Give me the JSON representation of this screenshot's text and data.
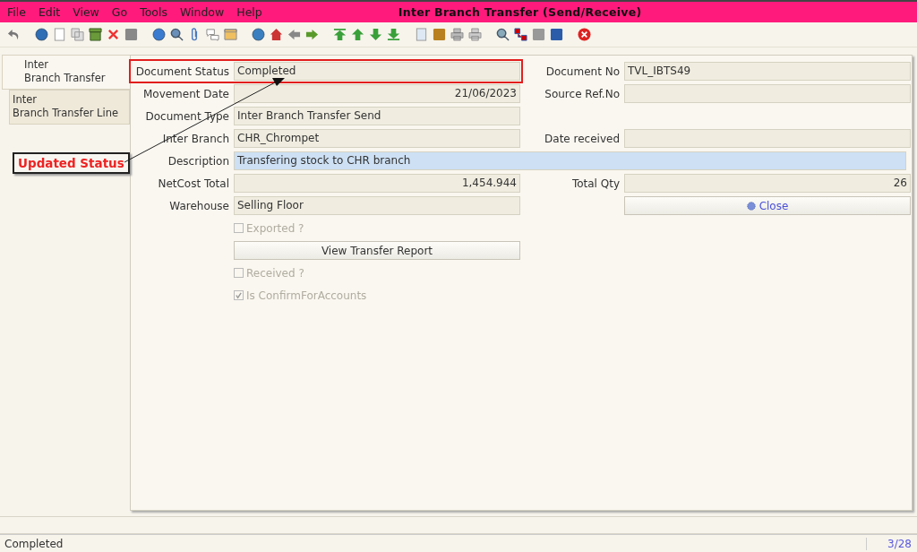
{
  "window": {
    "title": "Inter Branch Transfer (Send/Receive)"
  },
  "menu": [
    "File",
    "Edit",
    "View",
    "Go",
    "Tools",
    "Window",
    "Help"
  ],
  "tabs": [
    {
      "label": "Inter\nBranch Transfer",
      "selected": true
    },
    {
      "label": "Inter\nBranch Transfer Line",
      "selected": false
    }
  ],
  "rows": [
    {
      "highlighted": true,
      "left": {
        "kind": "text",
        "label": "Document Status",
        "value": "Completed",
        "editable": false
      },
      "right": {
        "kind": "text",
        "label": "Document No",
        "value": "TVL_IBTS49",
        "editable": false
      }
    },
    {
      "highlighted": false,
      "left": {
        "kind": "date",
        "label": "Movement Date",
        "value": "21/06/2023",
        "editable": false
      },
      "right": {
        "kind": "text",
        "label": "Source Ref.No",
        "editable": false
      }
    },
    {
      "highlighted": false,
      "left": {
        "kind": "text",
        "label": "Document Type",
        "value": "Inter Branch Transfer Send",
        "editable": false
      }
    },
    {
      "highlighted": false,
      "left": {
        "kind": "text",
        "label": "Inter Branch",
        "value": "CHR_Chrompet",
        "editable": false
      },
      "right": {
        "kind": "date",
        "label": "Date received",
        "editable": false
      }
    },
    {
      "highlighted": false,
      "wide": {
        "kind": "text",
        "label": "Description",
        "value": "Transfering stock to CHR branch",
        "editable": true
      }
    },
    {
      "highlighted": false,
      "left": {
        "kind": "number",
        "label": "NetCost Total",
        "value": "1,454.944",
        "editable": false
      },
      "right": {
        "kind": "number",
        "label": "Total Qty",
        "value": "26",
        "editable": false
      }
    },
    {
      "highlighted": false,
      "left": {
        "kind": "text",
        "label": "Warehouse",
        "value": "Selling Floor",
        "editable": false
      },
      "right": {
        "kind": "button",
        "label": "Close",
        "icon": true
      }
    },
    {
      "highlighted": false,
      "left": {
        "kind": "checkbox",
        "label": "Exported ?",
        "checked": false,
        "disabled": true
      }
    },
    {
      "highlighted": false,
      "left": {
        "kind": "button",
        "label": "View Transfer Report",
        "icon": false
      }
    },
    {
      "highlighted": false,
      "left": {
        "kind": "checkbox",
        "label": "Received ?",
        "checked": false,
        "disabled": true
      }
    },
    {
      "highlighted": false,
      "left": {
        "kind": "checkbox",
        "label": "Is ConfirmForAccounts",
        "checked": true,
        "disabled": true
      }
    }
  ],
  "annotation": {
    "text": "Updated Status"
  },
  "status_bar": {
    "message": "Completed",
    "record": "3/28"
  }
}
